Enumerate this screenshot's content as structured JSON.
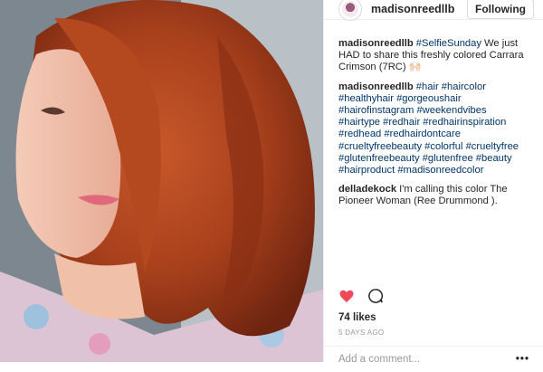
{
  "post": {
    "username": "madisonreedllb",
    "follow_label": "Following",
    "comments": [
      {
        "user": "madisonreedllb",
        "parts": [
          {
            "text": "#SelfieSunday",
            "tag": true
          },
          {
            "text": " We just HAD to share this freshly colored Carrara Crimson (7RC) 🙌🏻",
            "tag": false
          }
        ]
      },
      {
        "user": "madisonreedllb",
        "parts": [
          {
            "text": "#hair #haircolor #healthyhair #gorgeoushair #hairofinstagram #weekendvibes #hairtype #redhair #redhairinspiration #redhead #redhairdontcare #crueltyfreebeauty #colorful #crueltyfree #glutenfreebeauty #glutenfree #beauty #hairproduct #madisonreedcolor",
            "tag": true
          }
        ]
      },
      {
        "user": "delladekock",
        "parts": [
          {
            "text": " I'm calling this color The Pioneer Woman (Ree Drummond ).",
            "tag": false
          }
        ]
      }
    ],
    "likes": "74 likes",
    "time_ago": "5 DAYS AGO",
    "add_comment_placeholder": "Add a comment...",
    "more_options": "•••",
    "colors": {
      "like": "#ed4956",
      "hashtag": "#003569",
      "text": "#262626"
    },
    "icons": {
      "like": "heart-filled",
      "comment": "speech-bubble-outline"
    }
  }
}
